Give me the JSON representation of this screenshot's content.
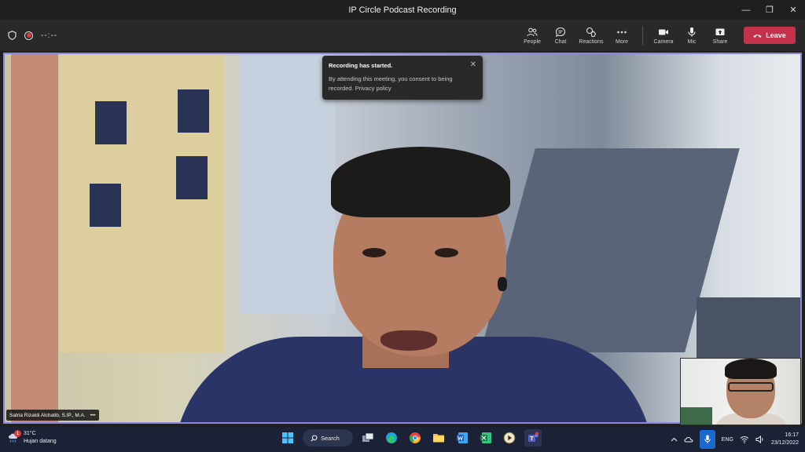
{
  "window": {
    "title": "IP Circle Podcast Recording",
    "controls": [
      "—",
      "❐",
      "✕"
    ]
  },
  "toolbar": {
    "timer": "--:--",
    "buttons": {
      "people": "People",
      "chat": "Chat",
      "reactions": "Reactions",
      "more": "More",
      "camera": "Camera",
      "mic": "Mic",
      "share": "Share"
    },
    "leave_label": "Leave"
  },
  "notification": {
    "title": "Recording has started.",
    "body": "By attending this meeting, you consent to being recorded. Privacy policy",
    "close": "✕"
  },
  "participant": {
    "name": "Satria Rizaldi Alchatib, S.IP., M.A.",
    "more": "•••"
  },
  "taskbar": {
    "weather": {
      "badge": "1",
      "temp": "31°C",
      "condition": "Hujan datang"
    },
    "search_label": "Search",
    "tray": {
      "lang": "ENG",
      "time": "16:17",
      "date": "23/12/2022"
    }
  },
  "colors": {
    "accent": "#8b87e0",
    "leave": "#c4314b",
    "toolbar": "#292929",
    "taskbar": "#1b2236"
  }
}
